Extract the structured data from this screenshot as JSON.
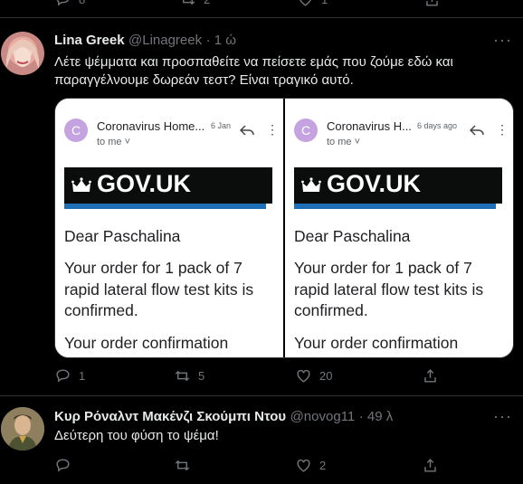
{
  "top_actions": {
    "replies": "8",
    "retweets": "2",
    "likes": "1"
  },
  "tweet1": {
    "name": "Lina Greek",
    "handle": "@Linagreek",
    "time": "· 1 ώ",
    "text_line1": "Λέτε ψέμματα και προσπαθείτε να πείσετε εμάς που ζούμε εδώ και",
    "text_line2": "παραγγέλνουμε δωρεάν τεστ? Είναι τραγικό αυτό.",
    "replies": "1",
    "retweets": "5",
    "likes": "20",
    "media": [
      {
        "avatar_letter": "C",
        "sender": "Coronavirus Home...",
        "date": "6 Jan",
        "to": "to me ˅",
        "banner": "GOV.UK",
        "greeting": "Dear Paschalina",
        "message": "Your order for 1 pack of 7 rapid lateral flow test kits is confirmed.",
        "footer": "Your order confirmation"
      },
      {
        "avatar_letter": "C",
        "sender": "Coronavirus H...",
        "date": "6 days ago",
        "to": "to me ˅",
        "banner": "GOV.UK",
        "greeting": "Dear Paschalina",
        "message": "Your order for 1 pack of 7 rapid lateral flow test kits is confirmed.",
        "footer": "Your order confirmation"
      }
    ]
  },
  "tweet2": {
    "name": "Κυρ Ρόναλντ Μακένζι Σκούμπι Ντου",
    "handle": "@novog11",
    "time": "· 49 λ",
    "text": "Δεύτερη του φύση το ψέμα!",
    "likes": "2"
  },
  "more_label": "···"
}
